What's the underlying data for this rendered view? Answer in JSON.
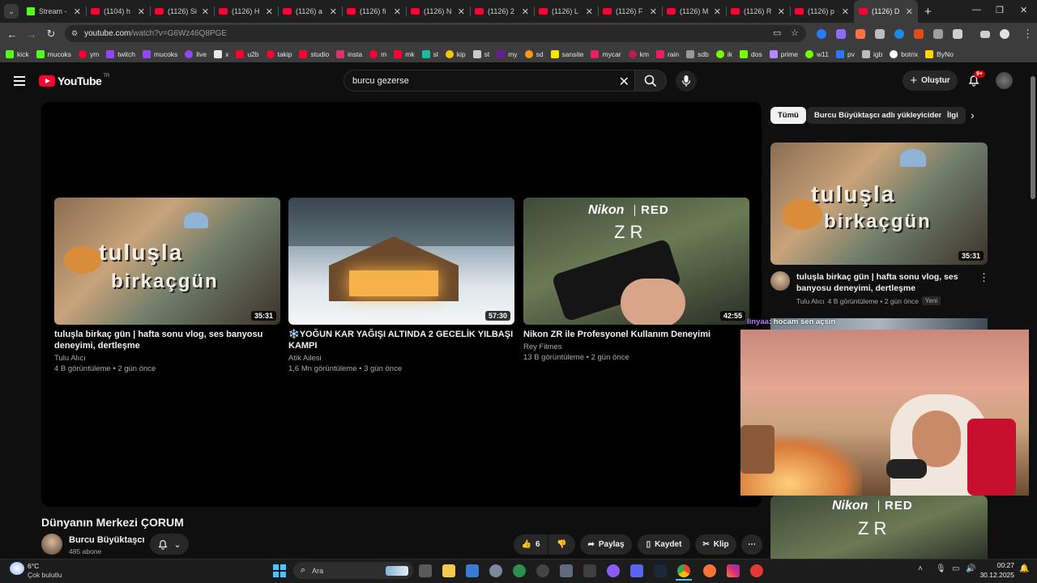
{
  "browser": {
    "tabs": [
      {
        "label": "Stream -",
        "kind": "kick"
      },
      {
        "label": "(1104) h",
        "kind": "yt"
      },
      {
        "label": "(1126) Si",
        "kind": "yt"
      },
      {
        "label": "(1126) H",
        "kind": "yt"
      },
      {
        "label": "(1126) a",
        "kind": "yt"
      },
      {
        "label": "(1126) fi",
        "kind": "yt"
      },
      {
        "label": "(1126) N",
        "kind": "yt"
      },
      {
        "label": "(1126) 2",
        "kind": "yt"
      },
      {
        "label": "(1126) L",
        "kind": "yt"
      },
      {
        "label": "(1126) F",
        "kind": "yt"
      },
      {
        "label": "(1126) M",
        "kind": "yt"
      },
      {
        "label": "(1126) R",
        "kind": "yt"
      },
      {
        "label": "(1126) p",
        "kind": "yt"
      },
      {
        "label": "(1126) D",
        "kind": "yt",
        "active": true
      }
    ],
    "url_host": "youtube.com",
    "url_path": "/watch?v=G6Wz46Q8PGE",
    "bookmarks": [
      {
        "label": "kick",
        "color": "#53fc18"
      },
      {
        "label": "mucoks",
        "color": "#53fc18"
      },
      {
        "label": "ym",
        "color": "#ff0033"
      },
      {
        "label": "twitch",
        "color": "#9146ff"
      },
      {
        "label": "mucoks",
        "color": "#9146ff"
      },
      {
        "label": "live",
        "color": "#9146ff"
      },
      {
        "label": "x",
        "color": "#e7e7e7"
      },
      {
        "label": "u2b",
        "color": "#ff0033"
      },
      {
        "label": "takip",
        "color": "#ff0033"
      },
      {
        "label": "studio",
        "color": "#ff0033"
      },
      {
        "label": "insta",
        "color": "#e1306c"
      },
      {
        "label": "m",
        "color": "#ff0033"
      },
      {
        "label": "mk",
        "color": "#ff0033"
      },
      {
        "label": "sl",
        "color": "#1abc9c"
      },
      {
        "label": "kip",
        "color": "#f5c518"
      },
      {
        "label": "st",
        "color": "#cccccc"
      },
      {
        "label": "my",
        "color": "#6a1b9a"
      },
      {
        "label": "sd",
        "color": "#f39c12"
      },
      {
        "label": "sansite",
        "color": "#f7e600"
      },
      {
        "label": "mycar",
        "color": "#e91e63"
      },
      {
        "label": "km",
        "color": "#c2185b"
      },
      {
        "label": "rain",
        "color": "#e91e63"
      },
      {
        "label": "sdb",
        "color": "#999999"
      },
      {
        "label": "ik",
        "color": "#76ff03"
      },
      {
        "label": "dos",
        "color": "#76ff03"
      },
      {
        "label": "prime",
        "color": "#b388ff"
      },
      {
        "label": "w11",
        "color": "#76ff03"
      },
      {
        "label": "pv",
        "color": "#2979ff"
      },
      {
        "label": "igb",
        "color": "#bbbbbb"
      },
      {
        "label": "botrix",
        "color": "#ffffff"
      },
      {
        "label": "ByNo",
        "color": "#ffd600"
      }
    ]
  },
  "youtube": {
    "logo_text": "YouTube",
    "country_code": "TR",
    "search_query": "burcu gezerse",
    "create_label": "Oluştur",
    "notification_count": "9+",
    "end_cards": [
      {
        "title": "tuluşla birkaç gün | hafta sonu vlog, ses banyosu deneyimi, dertleşme",
        "channel": "Tulu Alıcı",
        "stats": "4 B görüntüleme • 2 gün önce",
        "duration": "35:31",
        "thumb_text_1": "tuluşla",
        "thumb_text_2": "birkaçgün"
      },
      {
        "title": "❄️YOĞUN KAR YAĞIŞI ALTINDA 2 GECELİK YILBAŞI KAMPI",
        "channel": "Atik Ailesi",
        "stats": "1,6 Mn görüntüleme • 3 gün önce",
        "duration": "57:30"
      },
      {
        "title": "Nikon ZR ile Profesyonel Kullanım Deneyimi",
        "channel": "Rey Filmes",
        "stats": "13 B görüntüleme • 2 gün önce",
        "duration": "42:55",
        "brand_1": "Nikon",
        "brand_2": "RED",
        "model": "Z R"
      }
    ],
    "video_title": "Dünyanın Merkezi ÇORUM",
    "channel_name": "Burcu Büyüktaşcı",
    "subscribers": "485 abone",
    "likes": "6",
    "share_label": "Paylaş",
    "save_label": "Kaydet",
    "clip_label": "Klip",
    "chips": [
      "Tümü",
      "Burcu Büyüktaşcı adlı yükleyiciden",
      "İlgi"
    ],
    "recommended": [
      {
        "title": "tuluşla birkaç gün | hafta sonu vlog, ses banyosu deneyimi, dertleşme",
        "channel": "Tulu Alıcı",
        "stats": "4 B görüntüleme • 2 gün önce",
        "badge": "Yeni",
        "duration": "35:31"
      }
    ]
  },
  "overlay": {
    "chat_user": "linyaa",
    "chat_message": ": hocam sen açsın"
  },
  "taskbar": {
    "weather_temp": "6°C",
    "weather_desc": "Çok bulutlu",
    "search_label": "Ara",
    "time": "00:27",
    "date": "30.12.2025"
  }
}
